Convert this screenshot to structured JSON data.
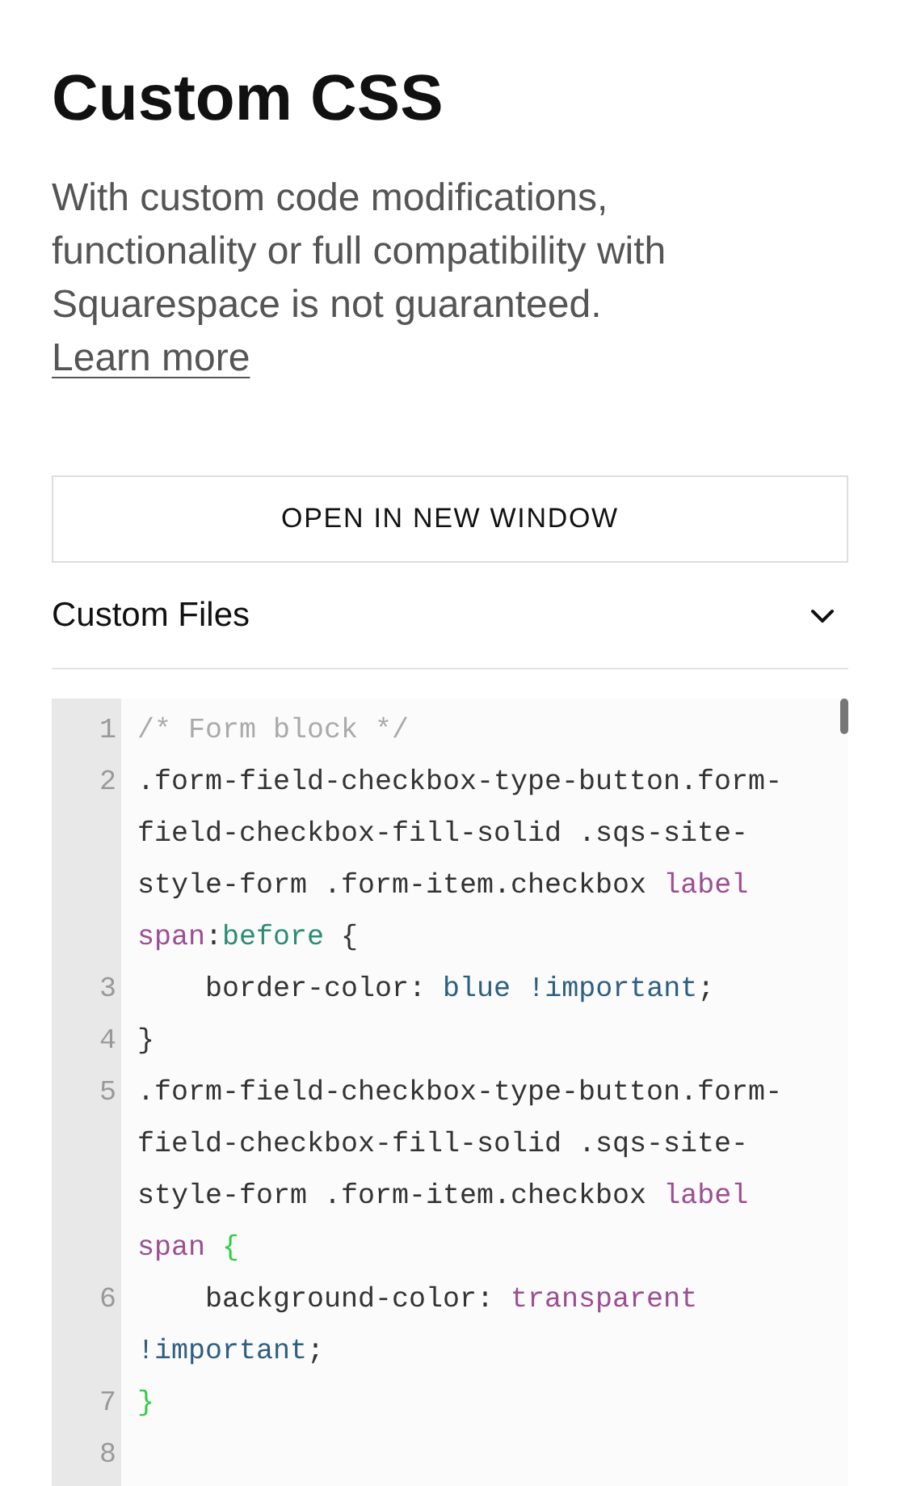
{
  "title": "Custom CSS",
  "description": {
    "text": "With custom code modifications, functionality or full compatibility with Squarespace is not guaranteed.",
    "link": "Learn more"
  },
  "open_button": "OPEN IN NEW WINDOW",
  "custom_files": {
    "label": "Custom Files",
    "expanded": false
  },
  "editor": {
    "lines": [
      {
        "number": "1",
        "tokens": [
          {
            "text": "/* Form block */",
            "kind": "comment"
          }
        ]
      },
      {
        "number": "2",
        "tokens": [
          {
            "text": ".form-field-checkbox-type-button.form-field-checkbox-fill-solid .sqs-site-style-form .form-item.checkbox ",
            "kind": "plain"
          },
          {
            "text": "label",
            "kind": "tag"
          },
          {
            "text": " span",
            "kind": "tag"
          },
          {
            "text": ":",
            "kind": "plain"
          },
          {
            "text": "before",
            "kind": "pseudo"
          },
          {
            "text": " {",
            "kind": "plain"
          }
        ]
      },
      {
        "number": "3",
        "tokens": [
          {
            "text": "    border-color: ",
            "kind": "plain"
          },
          {
            "text": "blue",
            "kind": "keyword"
          },
          {
            "text": " !important",
            "kind": "keyword"
          },
          {
            "text": ";",
            "kind": "plain"
          }
        ]
      },
      {
        "number": "4",
        "tokens": [
          {
            "text": "}",
            "kind": "plain"
          }
        ]
      },
      {
        "number": "5",
        "tokens": [
          {
            "text": ".form-field-checkbox-type-button.form-field-checkbox-fill-solid .sqs-site-style-form .form-item.checkbox ",
            "kind": "plain"
          },
          {
            "text": "label",
            "kind": "tag"
          },
          {
            "text": " span",
            "kind": "tag"
          },
          {
            "text": " {",
            "kind": "bracket"
          }
        ]
      },
      {
        "number": "6",
        "tokens": [
          {
            "text": "    background-color: ",
            "kind": "plain"
          },
          {
            "text": "transparent",
            "kind": "tag"
          },
          {
            "text": " !important",
            "kind": "keyword"
          },
          {
            "text": ";",
            "kind": "plain"
          }
        ]
      },
      {
        "number": "7",
        "tokens": [
          {
            "text": "}",
            "kind": "bracket"
          }
        ]
      },
      {
        "number": "8"
      }
    ]
  }
}
